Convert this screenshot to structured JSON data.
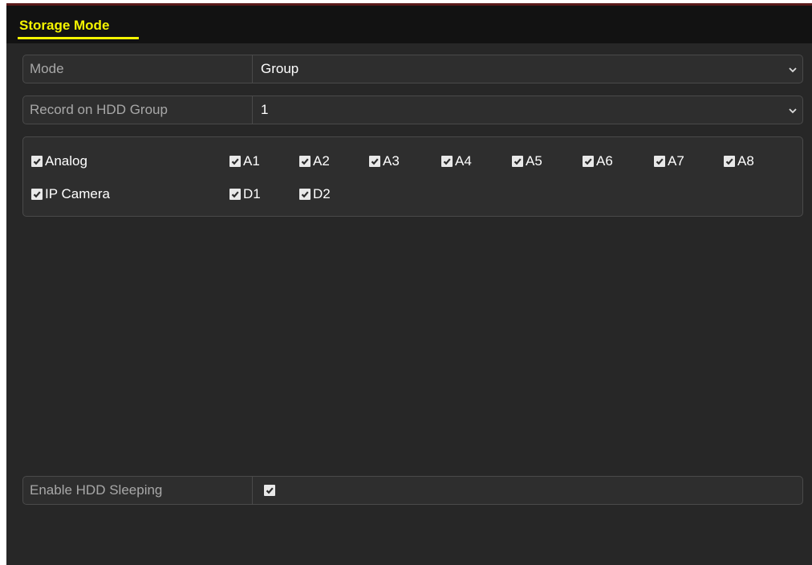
{
  "tabs": [
    {
      "label": "Storage Mode",
      "active": true
    }
  ],
  "colors": {
    "tab_active": "#f5f500",
    "panel_bg": "#272727",
    "label_text": "#a8a8a8",
    "value_text": "#ffffff"
  },
  "mode": {
    "label": "Mode",
    "value": "Group",
    "icon": "chevron-down-icon"
  },
  "record_group": {
    "label": "Record on HDD Group",
    "value": "1",
    "icon": "chevron-down-icon"
  },
  "channels": {
    "analog": {
      "label": "Analog",
      "checked": true,
      "items": [
        {
          "label": "A1",
          "checked": true
        },
        {
          "label": "A2",
          "checked": true
        },
        {
          "label": "A3",
          "checked": true
        },
        {
          "label": "A4",
          "checked": true
        },
        {
          "label": "A5",
          "checked": true
        },
        {
          "label": "A6",
          "checked": true
        },
        {
          "label": "A7",
          "checked": true
        },
        {
          "label": "A8",
          "checked": true
        }
      ]
    },
    "ip_camera": {
      "label": "IP Camera",
      "checked": true,
      "items": [
        {
          "label": "D1",
          "checked": true
        },
        {
          "label": "D2",
          "checked": true
        }
      ]
    }
  },
  "hdd_sleeping": {
    "label": "Enable HDD Sleeping",
    "checked": true
  }
}
